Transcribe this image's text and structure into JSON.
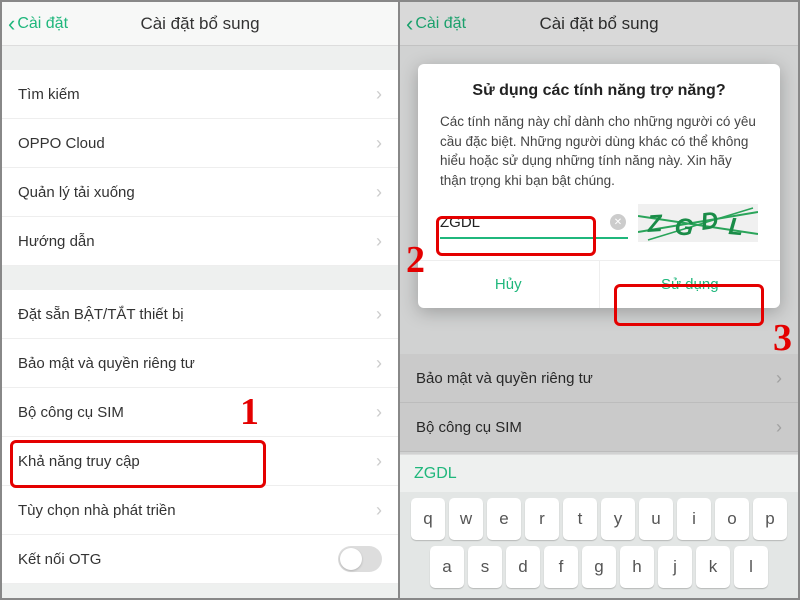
{
  "header": {
    "back": "Cài đặt",
    "title": "Cài đặt bổ sung"
  },
  "left": {
    "group1": [
      "Tìm kiếm",
      "OPPO Cloud",
      "Quản lý tải xuống",
      "Hướng dẫn"
    ],
    "group2": [
      "Đặt sẵn BẬT/TẮT thiết bị",
      "Bảo mật và quyền riêng tư",
      "Bộ công cụ SIM",
      "Khả năng truy cập",
      "Tùy chọn nhà phát triền",
      "Kết nối OTG"
    ]
  },
  "right": {
    "bg_rows": [
      "Bảo mật và quyền riêng tư",
      "Bộ công cụ SIM"
    ],
    "dialog": {
      "title": "Sử dụng các tính năng trợ năng?",
      "body": "Các tính năng này chỉ dành cho những người có yêu cầu đặc biệt. Những người dùng khác có thể không hiểu hoặc sử dụng những tính năng này. Xin hãy thận trọng khi bạn bật chúng.",
      "input_value": "ZGDL",
      "captcha_text": "ZGDL",
      "cancel": "Hủy",
      "confirm": "Sử dụng"
    },
    "keyboard": {
      "suggestion": "ZGDL",
      "rows": [
        [
          "q",
          "w",
          "e",
          "r",
          "t",
          "y",
          "u",
          "i",
          "o",
          "p"
        ],
        [
          "a",
          "s",
          "d",
          "f",
          "g",
          "h",
          "j",
          "k",
          "l"
        ]
      ]
    }
  },
  "steps": {
    "s1": "1",
    "s2": "2",
    "s3": "3"
  }
}
